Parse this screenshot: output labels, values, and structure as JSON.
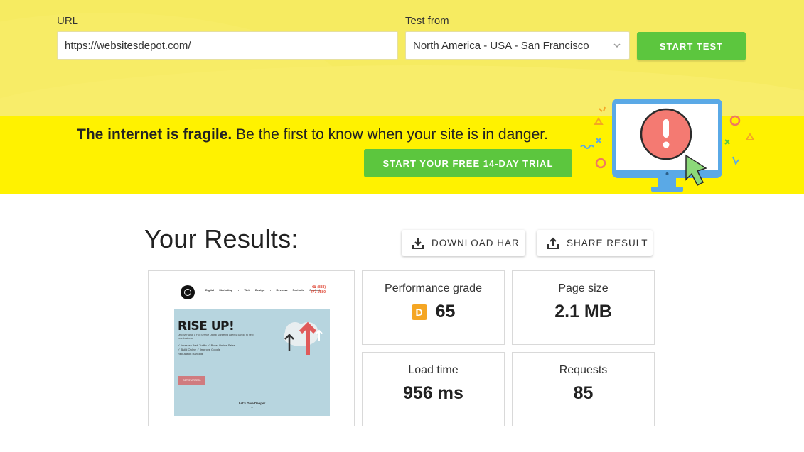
{
  "test_form": {
    "url_label": "URL",
    "url_value": "https://websitesdepot.com/",
    "from_label": "Test from",
    "from_value": "North America - USA - San Francisco",
    "start_button": "START TEST"
  },
  "promo": {
    "bold_text": "The internet is fragile.",
    "text": " Be the first to know when your site is in danger.",
    "trial_button": "START YOUR FREE 14-DAY TRIAL",
    "illustration_icon": "monitor-alert-icon"
  },
  "results": {
    "title": "Your Results:",
    "download_button": "DOWNLOAD HAR",
    "share_button": "SHARE RESULT",
    "metrics": {
      "performance": {
        "label": "Performance grade",
        "grade": "D",
        "score": "65",
        "grade_color": "#f5a623"
      },
      "page_size": {
        "label": "Page size",
        "value": "2.1 MB"
      },
      "load_time": {
        "label": "Load time",
        "value": "956 ms"
      },
      "requests": {
        "label": "Requests",
        "value": "85"
      }
    }
  },
  "screenshot": {
    "nav_items": "Digital Marketing ▾   Web Design ▾   Reviews   Portfolio   Contact",
    "phone_line1": "☎ (888)",
    "phone_line2": "477-9580",
    "headline": "RISE UP!",
    "subtext": "Discover what a Full Service Digital Marketing Agency can do to help your business",
    "check1": "✓ Increase Web Traffic   ✓ Boost Online Sales",
    "check2": "✓ Build Online      ✓ Improve Google",
    "check3": "   Reputation           Ranking",
    "cta": "GET STARTED ›",
    "footer": "Let's Dive Deeper"
  },
  "colors": {
    "top_bg": "#f6eb61",
    "promo_bg": "#fff200",
    "green": "#5cc63e",
    "grade_badge": "#f5a623"
  }
}
